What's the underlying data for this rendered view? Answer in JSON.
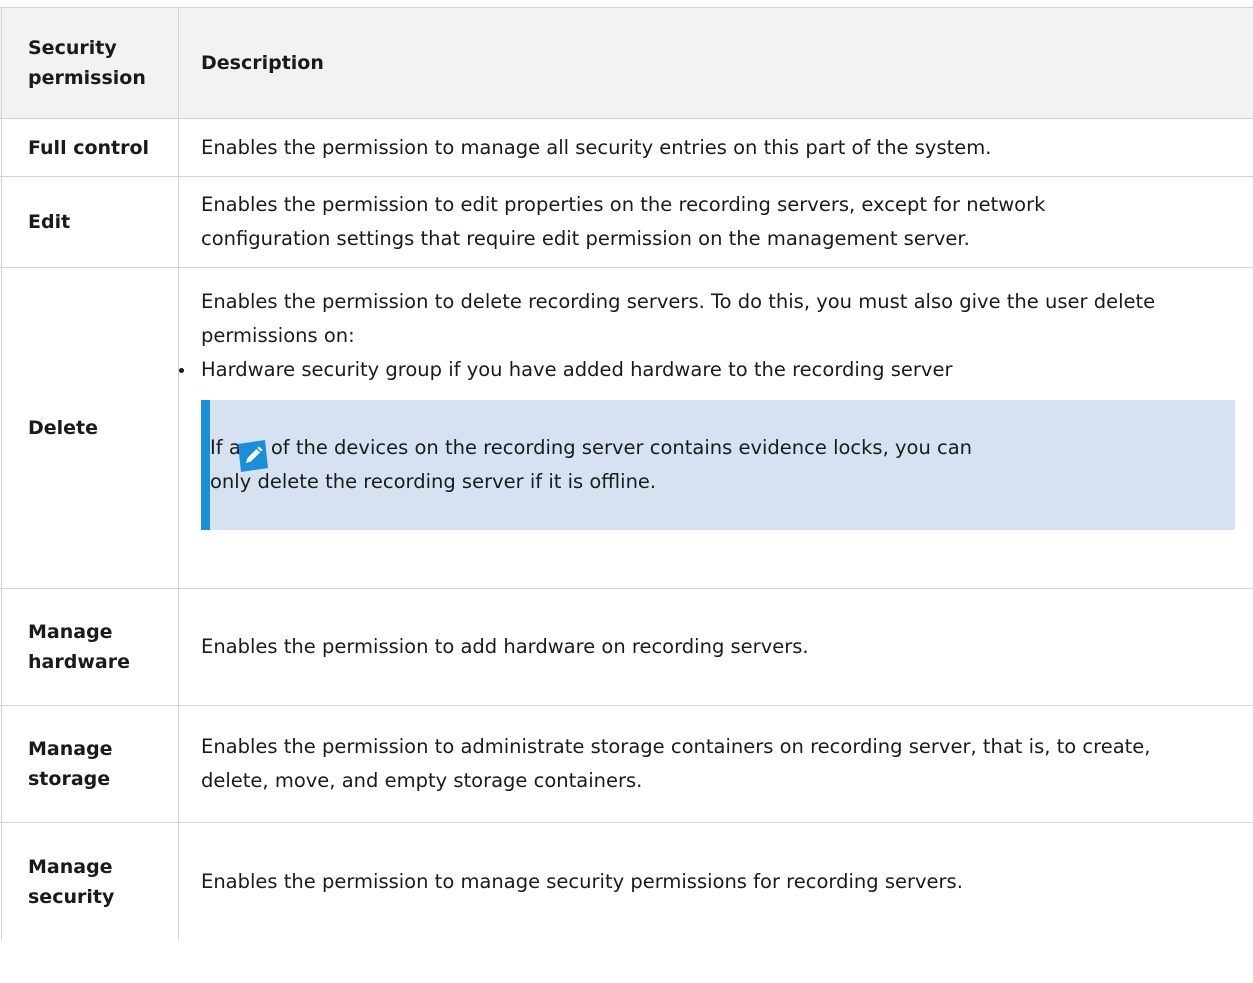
{
  "header": {
    "permission_label": "Security permission",
    "description_label": "Description"
  },
  "rows": [
    {
      "permission": "Full control",
      "description": "Enables the permission to manage all security entries on this part of the system."
    },
    {
      "permission": "Edit",
      "description": "Enables the permission to edit properties on the recording servers, except for network configuration settings that require edit permission on the management server."
    },
    {
      "permission": "Delete",
      "description": "Enables the permission to delete recording servers. To do this, you must also give the user delete permissions on:",
      "bullet": "Hardware security group if you have added hardware to the recording server",
      "note": "If any of the devices on the recording server contains evidence locks, you can only delete the recording server if it is offline.",
      "note_icon": "pencil-note-icon"
    },
    {
      "permission": "Manage hardware",
      "description": "Enables the permission to add hardware on recording servers."
    },
    {
      "permission": "Manage storage",
      "description": "Enables the permission to administrate storage containers on recording server, that is, to create, delete, move, and empty storage containers."
    },
    {
      "permission": "Manage security",
      "description": "Enables the permission to manage security permissions for recording servers."
    }
  ],
  "colors": {
    "header_bg": "#f2f2f2",
    "note_bg": "#d6e2f2",
    "note_accent": "#1a8ed8",
    "border": "#cfd3d6"
  }
}
